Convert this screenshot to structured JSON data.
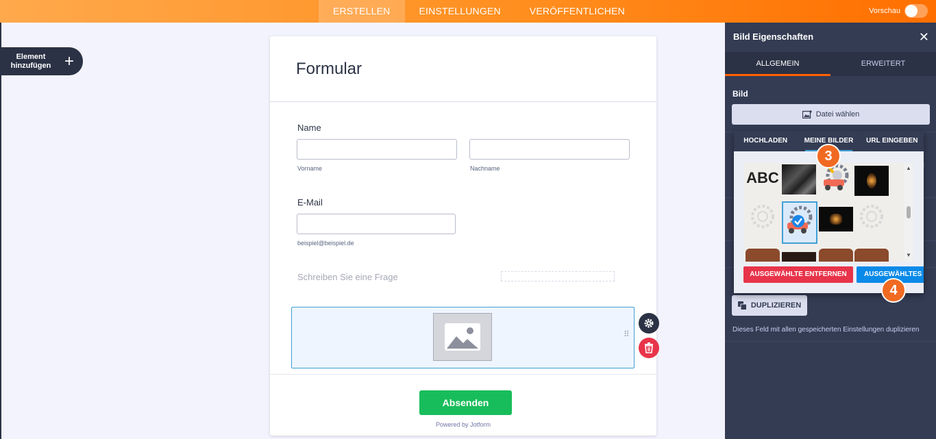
{
  "topbar": {
    "tabs": [
      {
        "label": "ERSTELLEN",
        "active": true
      },
      {
        "label": "EINSTELLUNGEN",
        "active": false
      },
      {
        "label": "VERÖFFENTLICHEN",
        "active": false
      }
    ],
    "preview_label": "Vorschau",
    "preview_on": false
  },
  "add_element": {
    "label": "Element hinzufügen",
    "icon": "plus-icon"
  },
  "form": {
    "title": "Formular",
    "name_label": "Name",
    "first_sublabel": "Vorname",
    "last_sublabel": "Nachname",
    "email_label": "E-Mail",
    "email_sublabel": "beispiel@beispiel.de",
    "question_placeholder": "Schreiben Sie eine Frage",
    "submit_label": "Absenden",
    "powered_by": "Powered by Jotform"
  },
  "panel": {
    "title": "Bild Eigenschaften",
    "tabs": [
      {
        "label": "ALLGEMEIN",
        "active": true
      },
      {
        "label": "ERWEITERT",
        "active": false
      }
    ],
    "bild_label": "Bild",
    "choose_file_label": "Datei wählen",
    "duplicate_label": "DUPLIZIEREN",
    "duplicate_desc": "Dieses Feld mit allen gespeicherten Einstellungen duplizieren"
  },
  "picker": {
    "tabs": [
      {
        "label": "HOCHLADEN",
        "active": false
      },
      {
        "label": "MEINE BILDER",
        "active": true
      },
      {
        "label": "URL EINGEBEN",
        "active": false
      }
    ],
    "thumb_text": "ABC",
    "remove_label": "AUSGEWÄHLTE ENTFERNEN",
    "use_label": "AUSGEWÄHLTES V"
  },
  "badges": {
    "step3": "3",
    "step4": "4"
  },
  "colors": {
    "accent": "#ff6100",
    "panel_bg": "#343c54",
    "submit": "#18bd5b",
    "delete": "#e8344a",
    "badge": "#f06a22"
  }
}
